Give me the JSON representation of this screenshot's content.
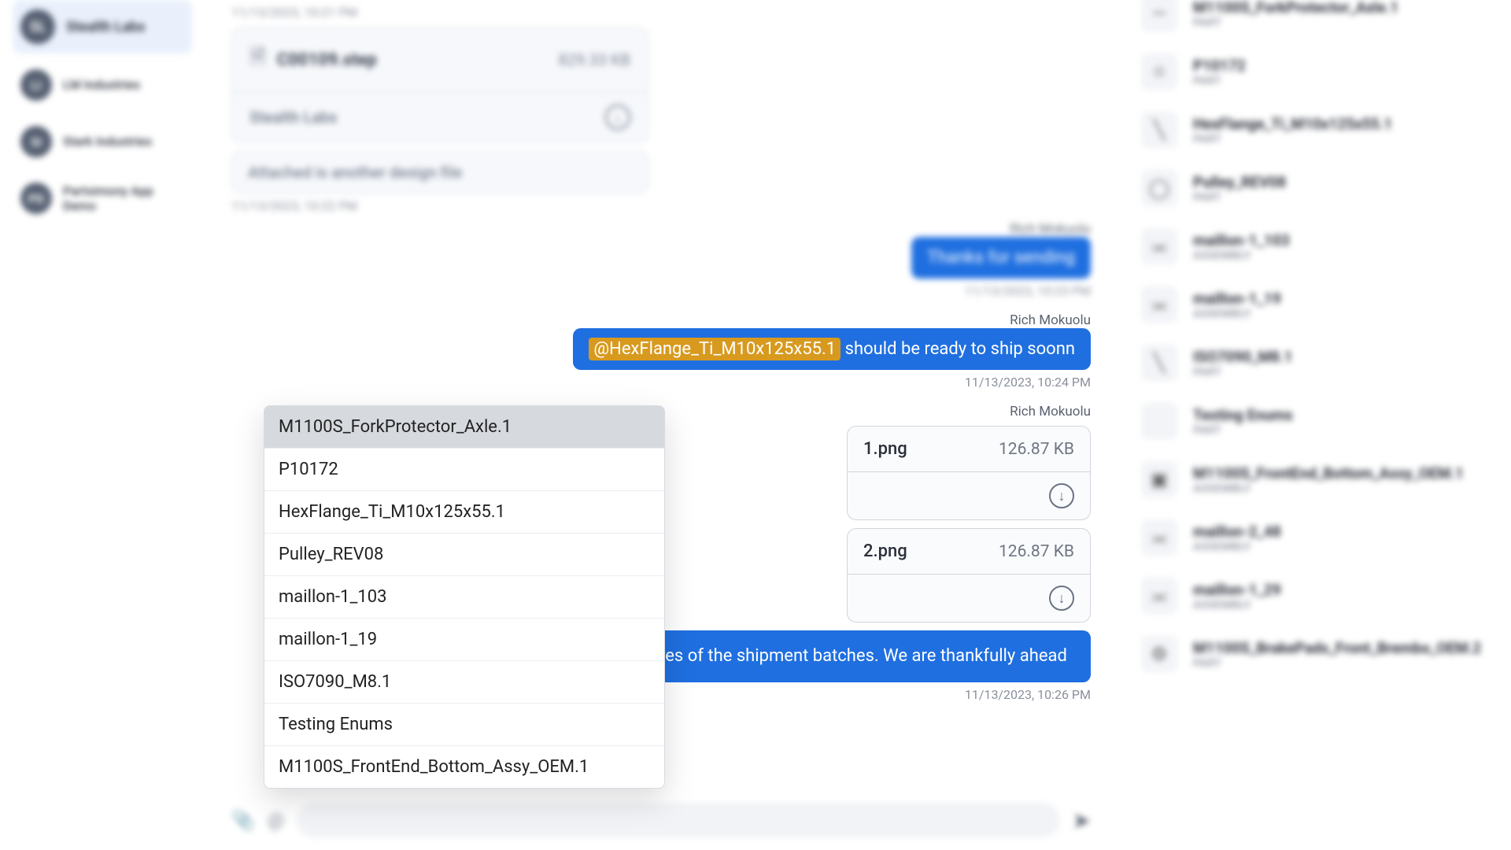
{
  "sidebar": {
    "items": [
      {
        "initials": "",
        "label": ""
      },
      {
        "initials": "LI",
        "label": "LM Industries"
      },
      {
        "initials": "SI",
        "label": "Stark Industries"
      },
      {
        "initials": "PD",
        "label": "Partsimony App Demo"
      }
    ]
  },
  "chat": {
    "ts1": "11/13/2023, 10:21 PM",
    "file1": {
      "name": "C00109.step",
      "size": "829.33 KB",
      "source": "Stealth Labs"
    },
    "note1": "Attached is another design file",
    "ts2": "11/13/2023, 10:22 PM",
    "sender_out": "Rich Mokuolu",
    "bubble_thanks": "Thanks for sending",
    "ts3": "11/13/2023, 10:23 PM",
    "sender_out2": "Rich Mokuolu",
    "mention_tag": "@HexFlange_Ti_M10x125x55.1",
    "mention_rest": " should be ready to ship soonn",
    "ts4": "11/13/2023, 10:24 PM",
    "sender_out3": "Rich Mokuolu",
    "img1": {
      "suffix": "1.png",
      "size": "126.87 KB"
    },
    "img2": {
      "suffix": "2.png",
      "size": "126.87 KB"
    },
    "wide_text_partial": "res of the shipment batches. We are thankfully ahead",
    "ts5": "11/13/2023, 10:26 PM"
  },
  "mention_menu": [
    "M1100S_ForkProtector_Axle.1",
    "P10172",
    "HexFlange_Ti_M10x125x55.1",
    "Pulley_REV08",
    "maillon-1_103",
    "maillon-1_19",
    "ISO7090_M8.1",
    "Testing Enums",
    "M1100S_FrontEnd_Bottom_Assy_OEM.1"
  ],
  "parts": [
    {
      "name": "M1100S_ForkProtector_Axle.1",
      "type": "PART"
    },
    {
      "name": "P10172",
      "type": "PART"
    },
    {
      "name": "HexFlange_Ti_M10x125x55.1",
      "type": "PART"
    },
    {
      "name": "Pulley_REV08",
      "type": "PART"
    },
    {
      "name": "maillon-1_103",
      "type": "ASSEMBLY"
    },
    {
      "name": "maillon-1_19",
      "type": "ASSEMBLY"
    },
    {
      "name": "ISO7090_M8.1",
      "type": "PART"
    },
    {
      "name": "Testing Enums",
      "type": "PART"
    },
    {
      "name": "M1100S_FrontEnd_Bottom_Assy_OEM.1",
      "type": "ASSEMBLY"
    },
    {
      "name": "maillon-2_48",
      "type": "ASSEMBLY"
    },
    {
      "name": "maillon-1_29",
      "type": "ASSEMBLY"
    },
    {
      "name": "M1100S_BrakePads_Front_Brembo_OEM.2",
      "type": "PART"
    }
  ]
}
